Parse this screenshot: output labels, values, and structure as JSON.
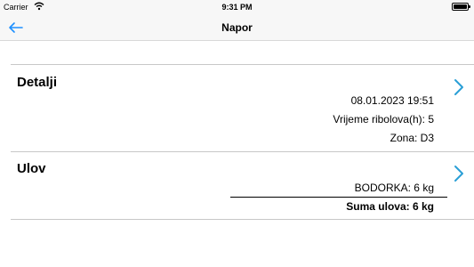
{
  "status_bar": {
    "carrier": "Carrier",
    "time": "9:31 PM",
    "wifi_icon": "wifi-icon",
    "battery_icon": "battery-icon"
  },
  "nav": {
    "title": "Napor",
    "back_icon": "back-arrow-icon",
    "accent_color": "#1e90ff"
  },
  "sections": {
    "details": {
      "title": "Detalji",
      "date": "08.01.2023 19:51",
      "fishing_time": "Vrijeme ribolova(h): 5",
      "zone": "Zona: D3"
    },
    "catch": {
      "title": "Ulov",
      "items": [
        "BODORKA: 6 kg"
      ],
      "total": "Suma ulova: 6 kg"
    }
  },
  "colors": {
    "chevron": "#2a9fd6",
    "divider": "#c8c8c8"
  }
}
